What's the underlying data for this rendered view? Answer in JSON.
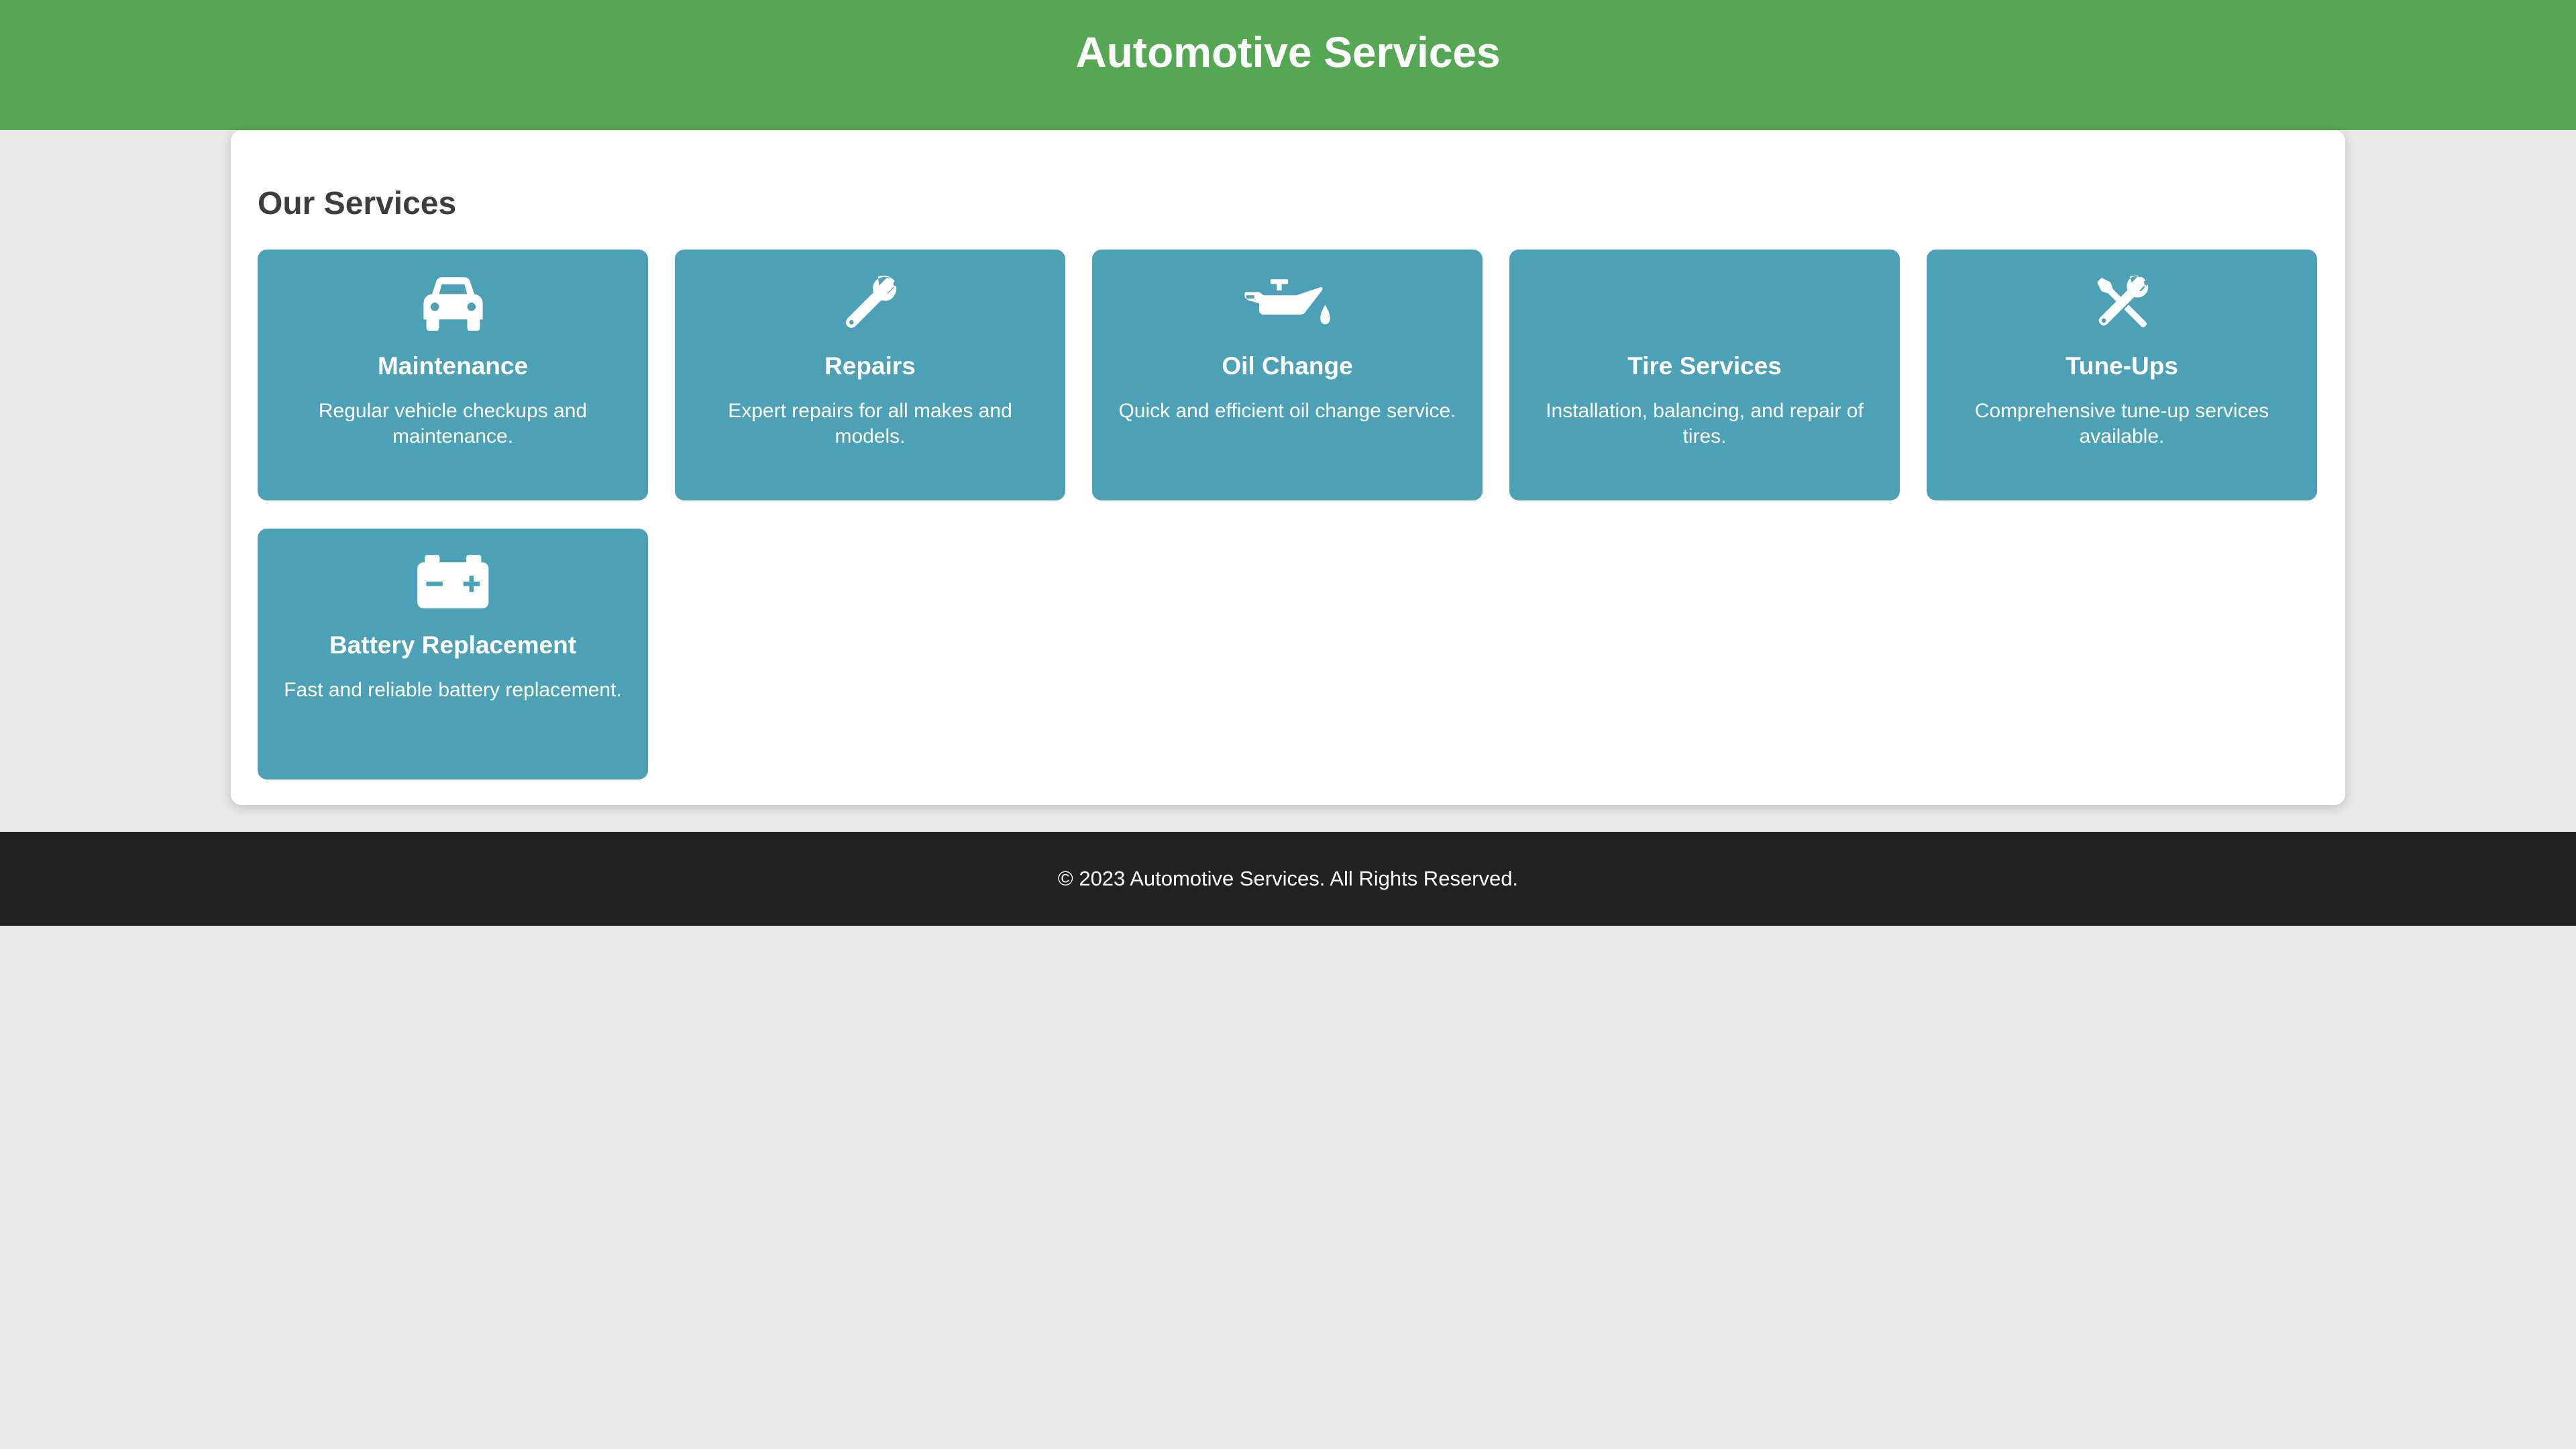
{
  "header": {
    "title": "Automotive Services"
  },
  "main": {
    "section_title": "Our Services",
    "services": [
      {
        "title": "Maintenance",
        "description": "Regular vehicle checkups and maintenance.",
        "icon": "car-icon"
      },
      {
        "title": "Repairs",
        "description": "Expert repairs for all makes and models.",
        "icon": "wrench-icon"
      },
      {
        "title": "Oil Change",
        "description": "Quick and efficient oil change service.",
        "icon": "oil-can-icon"
      },
      {
        "title": "Tire Services",
        "description": "Installation, balancing, and repair of tires.",
        "icon": "tire-icon"
      },
      {
        "title": "Tune-Ups",
        "description": "Comprehensive tune-up services available.",
        "icon": "screwdriver-wrench-icon"
      },
      {
        "title": "Battery Replacement",
        "description": "Fast and reliable battery replacement.",
        "icon": "battery-icon"
      }
    ]
  },
  "footer": {
    "text": "© 2023 Automotive Services. All Rights Reserved."
  },
  "colors": {
    "header_bg": "#55a753",
    "card_bg": "#4ca1b6",
    "footer_bg": "#222222",
    "page_bg": "#e9e9e9"
  }
}
